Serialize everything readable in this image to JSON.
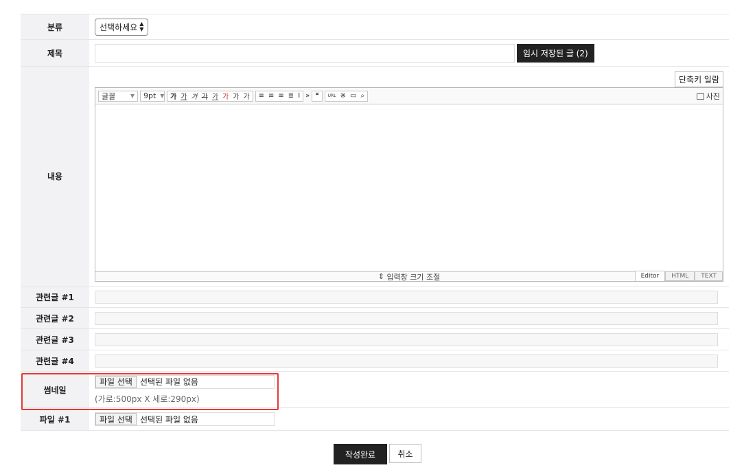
{
  "form": {
    "category": {
      "label": "분류",
      "select_value": "선택하세요"
    },
    "title": {
      "label": "제목",
      "temp_saved_button": "임시 저장된 글 (2)"
    },
    "content": {
      "label": "내용",
      "shortcut_button": "단축키 일람",
      "toolbar": {
        "font": "글꼴",
        "size": "9pt",
        "format_buttons": [
          "가",
          "가",
          "가",
          "가",
          "가",
          "가",
          "가",
          "가"
        ],
        "photo": "사진"
      },
      "resize_label": "입력창 크기 조절",
      "modes": [
        "Editor",
        "HTML",
        "TEXT"
      ]
    },
    "related": [
      {
        "label": "관련글 #1"
      },
      {
        "label": "관련글 #2"
      },
      {
        "label": "관련글 #3"
      },
      {
        "label": "관련글 #4"
      }
    ],
    "thumbnail": {
      "label": "썸네일",
      "file_button": "파일 선택",
      "file_status": "선택된 파일 없음",
      "hint": "(가로:500px X 세로:290px)"
    },
    "file1": {
      "label": "파일 #1",
      "file_button": "파일 선택",
      "file_status": "선택된 파일 없음"
    }
  },
  "actions": {
    "submit": "작성완료",
    "cancel": "취소"
  },
  "colors": {
    "highlight": "#e53935",
    "dark_button": "#222222",
    "label_bg": "#f2f2f4"
  }
}
